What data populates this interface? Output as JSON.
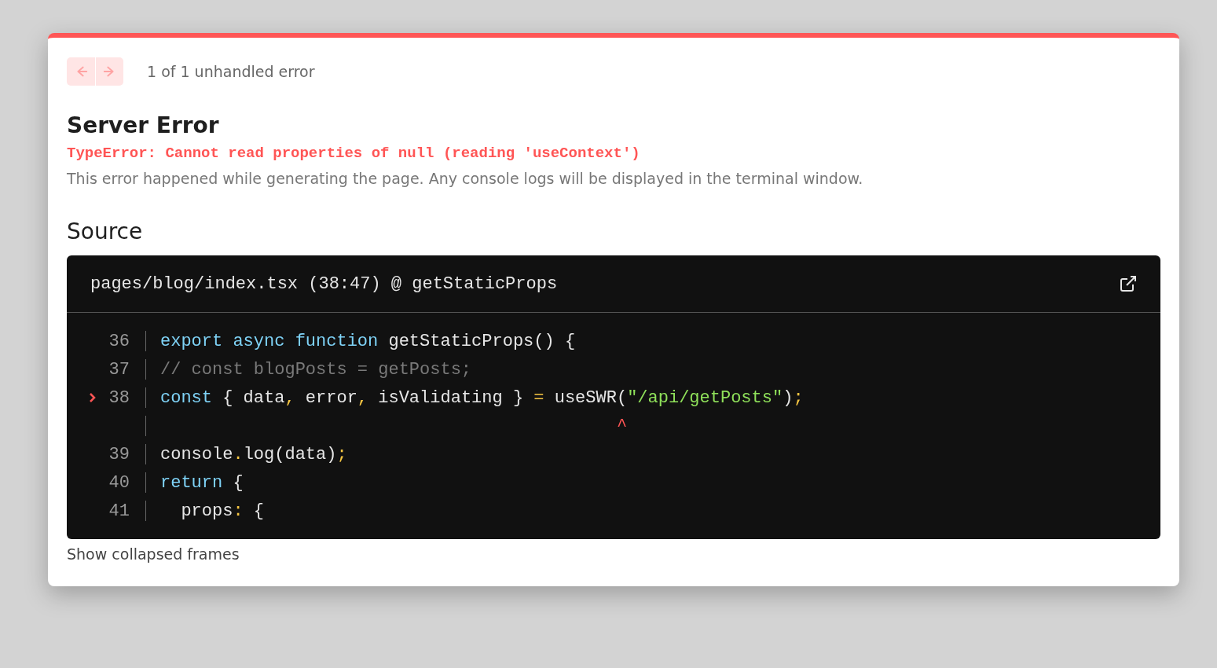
{
  "pager": {
    "prev": {
      "disabled": true
    },
    "next": {
      "disabled": true
    },
    "count": "1 of 1 unhandled error"
  },
  "title": "Server Error",
  "error_message": "TypeError: Cannot read properties of null (reading 'useContext')",
  "description": "This error happened while generating the page. Any console logs will be displayed in the terminal window.",
  "source": {
    "heading": "Source",
    "file": "pages/blog/index.tsx (38:47) @ getStaticProps",
    "lines": [
      {
        "kind": "code",
        "number": "36",
        "error": false,
        "tokens": [
          {
            "kind": "keyword",
            "text": "export async function"
          },
          {
            "kind": "plain",
            "text": " getStaticProps() {"
          }
        ]
      },
      {
        "kind": "code",
        "number": "37",
        "error": false,
        "tokens": [
          {
            "kind": "comment",
            "text": "// const blogPosts = getPosts;"
          }
        ]
      },
      {
        "kind": "code",
        "number": "38",
        "error": true,
        "tokens": [
          {
            "kind": "keyword",
            "text": "const"
          },
          {
            "kind": "plain",
            "text": " { data"
          },
          {
            "kind": "punct",
            "text": ","
          },
          {
            "kind": "plain",
            "text": " error"
          },
          {
            "kind": "punct",
            "text": ","
          },
          {
            "kind": "plain",
            "text": " isValidating } "
          },
          {
            "kind": "punct",
            "text": "="
          },
          {
            "kind": "plain",
            "text": " useSWR("
          },
          {
            "kind": "string",
            "text": "\"/api/getPosts\""
          },
          {
            "kind": "plain",
            "text": ")"
          },
          {
            "kind": "punct",
            "text": ";"
          }
        ]
      },
      {
        "kind": "caret",
        "text": "                                            ^"
      },
      {
        "kind": "code",
        "number": "39",
        "error": false,
        "tokens": [
          {
            "kind": "plain",
            "text": "console"
          },
          {
            "kind": "punct",
            "text": "."
          },
          {
            "kind": "plain",
            "text": "log(data)"
          },
          {
            "kind": "punct",
            "text": ";"
          }
        ]
      },
      {
        "kind": "code",
        "number": "40",
        "error": false,
        "tokens": [
          {
            "kind": "keyword",
            "text": "return"
          },
          {
            "kind": "plain",
            "text": " {"
          }
        ]
      },
      {
        "kind": "code",
        "number": "41",
        "error": false,
        "tokens": [
          {
            "kind": "plain",
            "text": "  props"
          },
          {
            "kind": "punct",
            "text": ":"
          },
          {
            "kind": "plain",
            "text": " {"
          }
        ]
      }
    ]
  },
  "collapsed_link": "Show collapsed frames"
}
